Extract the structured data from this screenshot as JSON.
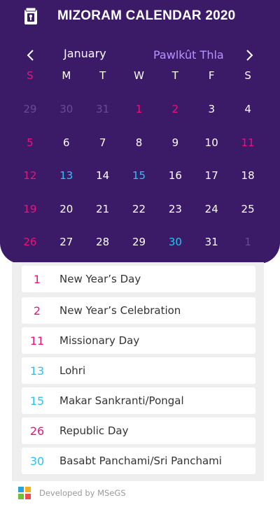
{
  "app": {
    "title": "MIZORAM CALENDAR 2020"
  },
  "nav": {
    "month_en": "January",
    "month_mz": "Pawlkût Thla"
  },
  "weekdays": [
    "S",
    "M",
    "T",
    "W",
    "T",
    "F",
    "S"
  ],
  "calendar": {
    "weeks": [
      [
        {
          "d": "29",
          "t": "other"
        },
        {
          "d": "30",
          "t": "other"
        },
        {
          "d": "31",
          "t": "other"
        },
        {
          "d": "1",
          "t": "holiday_pink"
        },
        {
          "d": "2",
          "t": "holiday_pink"
        },
        {
          "d": "3",
          "t": "normal"
        },
        {
          "d": "4",
          "t": "normal"
        }
      ],
      [
        {
          "d": "5",
          "t": "sunday"
        },
        {
          "d": "6",
          "t": "normal"
        },
        {
          "d": "7",
          "t": "normal"
        },
        {
          "d": "8",
          "t": "normal"
        },
        {
          "d": "9",
          "t": "normal"
        },
        {
          "d": "10",
          "t": "normal"
        },
        {
          "d": "11",
          "t": "holiday_pink"
        }
      ],
      [
        {
          "d": "12",
          "t": "sunday"
        },
        {
          "d": "13",
          "t": "holiday_blue"
        },
        {
          "d": "14",
          "t": "normal"
        },
        {
          "d": "15",
          "t": "holiday_blue"
        },
        {
          "d": "16",
          "t": "normal"
        },
        {
          "d": "17",
          "t": "normal"
        },
        {
          "d": "18",
          "t": "normal"
        }
      ],
      [
        {
          "d": "19",
          "t": "sunday"
        },
        {
          "d": "20",
          "t": "normal"
        },
        {
          "d": "21",
          "t": "normal"
        },
        {
          "d": "22",
          "t": "normal"
        },
        {
          "d": "23",
          "t": "normal"
        },
        {
          "d": "24",
          "t": "normal"
        },
        {
          "d": "25",
          "t": "normal"
        }
      ],
      [
        {
          "d": "26",
          "t": "sunday"
        },
        {
          "d": "27",
          "t": "normal"
        },
        {
          "d": "28",
          "t": "normal"
        },
        {
          "d": "29",
          "t": "normal"
        },
        {
          "d": "30",
          "t": "holiday_blue"
        },
        {
          "d": "31",
          "t": "normal"
        },
        {
          "d": "1",
          "t": "other"
        }
      ]
    ]
  },
  "holidays": [
    {
      "num": "1",
      "name": "New Year’s Day",
      "type": "pink"
    },
    {
      "num": "2",
      "name": "New Year’s Celebration",
      "type": "pink"
    },
    {
      "num": "11",
      "name": "Missionary Day",
      "type": "pink"
    },
    {
      "num": "13",
      "name": "Lohri",
      "type": "blue"
    },
    {
      "num": "15",
      "name": "Makar Sankranti/Pongal",
      "type": "blue"
    },
    {
      "num": "26",
      "name": "Republic Day",
      "type": "pink"
    },
    {
      "num": "30",
      "name": "Basabt Panchami/Sri Panchami",
      "type": "blue"
    }
  ],
  "footer": {
    "text": "Developed by MSeGS"
  },
  "colors": {
    "header_bg": "#3b1a68",
    "pink": "#e8157a",
    "blue": "#29c4f0",
    "other_month": "#6a4b96",
    "accent_purple": "#b694ff"
  }
}
